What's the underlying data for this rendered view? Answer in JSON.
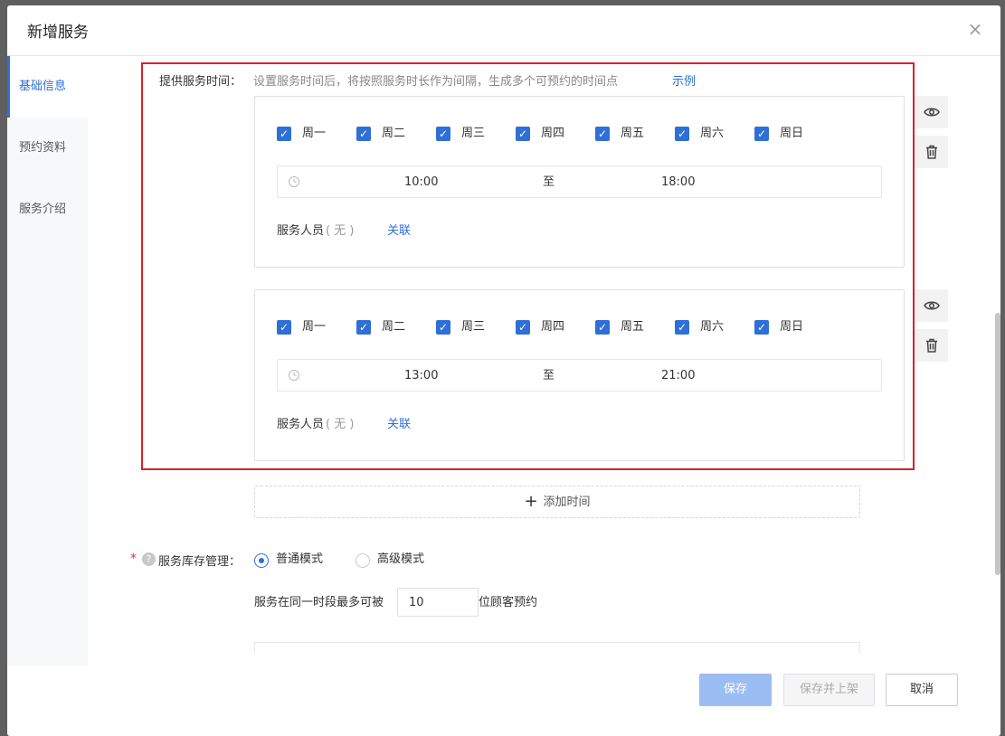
{
  "dialog": {
    "title": "新增服务",
    "close_icon": "close-icon"
  },
  "sidebar": {
    "items": [
      {
        "label": "基础信息",
        "active": true
      },
      {
        "label": "预约资料",
        "active": false
      },
      {
        "label": "服务介绍",
        "active": false
      }
    ]
  },
  "service_time": {
    "label": "提供服务时间：",
    "hint": "设置服务时间后，将按照服务时长作为间隔，生成多个可预约的时间点",
    "example_link": "示例",
    "slots": [
      {
        "days": [
          {
            "label": "周一",
            "checked": true
          },
          {
            "label": "周二",
            "checked": true
          },
          {
            "label": "周三",
            "checked": true
          },
          {
            "label": "周四",
            "checked": true
          },
          {
            "label": "周五",
            "checked": true
          },
          {
            "label": "周六",
            "checked": true
          },
          {
            "label": "周日",
            "checked": true
          }
        ],
        "start": "10:00",
        "separator": "至",
        "end": "18:00",
        "staff_label": "服务人员",
        "staff_value": "( 无 )",
        "staff_link": "关联"
      },
      {
        "days": [
          {
            "label": "周一",
            "checked": true
          },
          {
            "label": "周二",
            "checked": true
          },
          {
            "label": "周三",
            "checked": true
          },
          {
            "label": "周四",
            "checked": true
          },
          {
            "label": "周五",
            "checked": true
          },
          {
            "label": "周六",
            "checked": true
          },
          {
            "label": "周日",
            "checked": true
          }
        ],
        "start": "13:00",
        "separator": "至",
        "end": "21:00",
        "staff_label": "服务人员",
        "staff_value": "( 无 )",
        "staff_link": "关联"
      }
    ],
    "add_time_label": "添加时间"
  },
  "inventory": {
    "required_mark": "*",
    "help_mark": "?",
    "label": "服务库存管理：",
    "options": [
      {
        "label": "普通模式",
        "selected": true
      },
      {
        "label": "高级模式",
        "selected": false
      }
    ],
    "capacity_prefix": "服务在同一时段最多可被",
    "capacity_value": "10",
    "capacity_suffix": "位顾客预约"
  },
  "footer": {
    "save_label": "保存",
    "save_publish_label": "保存并上架",
    "cancel_label": "取消"
  },
  "colors": {
    "accent": "#2e6fd8",
    "highlight_border": "#d9202b"
  }
}
